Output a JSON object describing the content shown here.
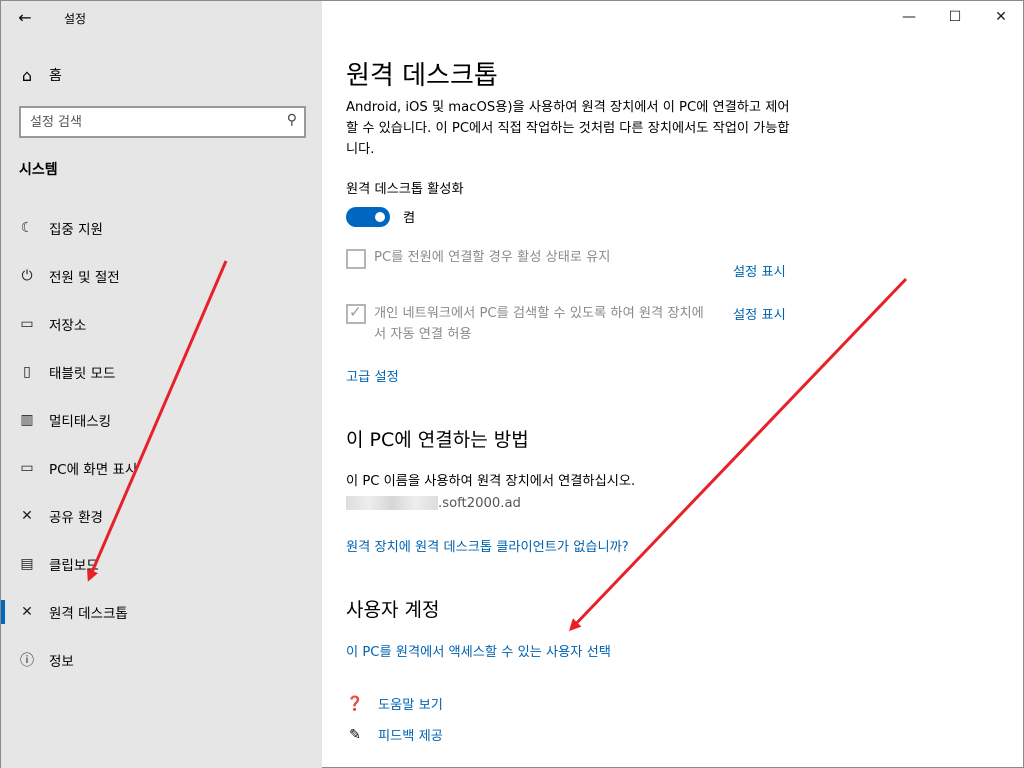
{
  "app": {
    "title": "설정",
    "back": "←"
  },
  "window_controls": {
    "minimize": "—",
    "maximize": "☐",
    "close": "✕"
  },
  "sidebar": {
    "home": {
      "icon": "home-icon",
      "glyph": "⌂",
      "label": "홈"
    },
    "search": {
      "placeholder": "설정 검색",
      "icon": "search-icon",
      "glyph": "⚲"
    },
    "section_title": "시스템",
    "items": [
      {
        "icon": "moon-icon",
        "glyph": "☾",
        "label": "집중 지원"
      },
      {
        "icon": "power-icon",
        "glyph": "⏻",
        "label": "전원 및 절전"
      },
      {
        "icon": "storage-icon",
        "glyph": "▭",
        "label": "저장소"
      },
      {
        "icon": "tablet-icon",
        "glyph": "▯",
        "label": "태블릿 모드"
      },
      {
        "icon": "multitask-icon",
        "glyph": "▥",
        "label": "멀티태스킹"
      },
      {
        "icon": "project-icon",
        "glyph": "▭",
        "label": "PC에 화면 표시"
      },
      {
        "icon": "share-icon",
        "glyph": "✕",
        "label": "공유 환경"
      },
      {
        "icon": "clipboard-icon",
        "glyph": "▤",
        "label": "클립보드"
      },
      {
        "icon": "remote-desktop-icon",
        "glyph": "✕",
        "label": "원격 데스크톱",
        "selected": true
      },
      {
        "icon": "info-icon",
        "glyph": "ⓘ",
        "label": "정보"
      }
    ]
  },
  "main": {
    "title": "원격 데스크톱",
    "description": "Android, iOS 및 macOS용)을 사용하여 원격 장치에서 이 PC에 연결하고 제어할 수 있습니다. 이 PC에서 직접 작업하는 것처럼 다른 장치에서도 작업이 가능합니다.",
    "enable_label": "원격 데스크톱 활성화",
    "toggle_state": "켬",
    "toggle_on": true,
    "checkbox1": {
      "label": "PC를 전원에 연결할 경우 활성 상태로 유지",
      "checked": false
    },
    "checkbox2": {
      "label": "개인 네트워크에서 PC를 검색할 수 있도록 하여 원격 장치에서 자동 연결 허용",
      "checked": true
    },
    "show_settings": "설정 표시",
    "advanced": "고급 설정",
    "connect_heading": "이 PC에 연결하는 방법",
    "connect_desc": "이 PC 이름을 사용하여 원격 장치에서 연결하십시오.",
    "pc_name_suffix": ".soft2000.ad",
    "no_client": "원격 장치에 원격 데스크톱 클라이언트가 없습니까?",
    "user_heading": "사용자 계정",
    "choose_users": "이 PC를 원격에서 액세스할 수 있는 사용자 선택",
    "help": {
      "icon": "help-chat-icon",
      "glyph": "❓",
      "label": "도움말 보기"
    },
    "feedback": {
      "icon": "feedback-icon",
      "glyph": "✎",
      "label": "피드백 제공"
    }
  },
  "colors": {
    "accent": "#0067c0",
    "link": "#0063b1",
    "sidebar_bg": "#e6e6e6",
    "annotation": "#e8202a"
  }
}
